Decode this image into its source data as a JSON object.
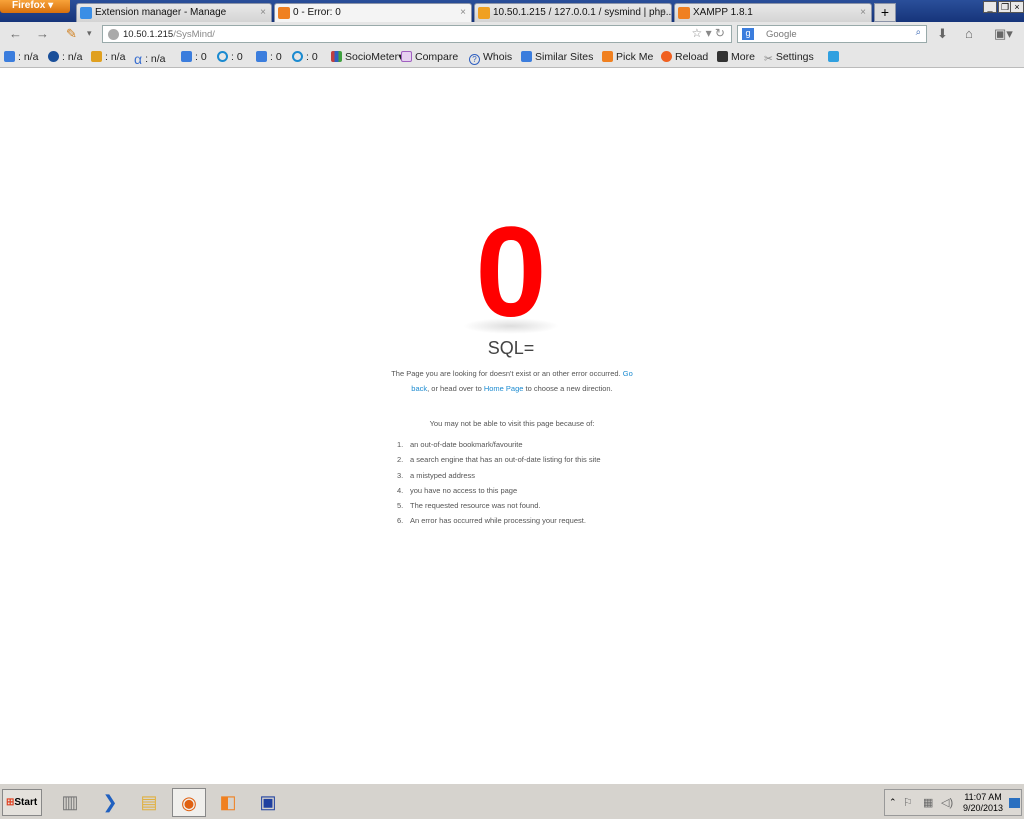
{
  "browser": {
    "menu_label": "Firefox",
    "tabs": [
      {
        "label": "Extension manager - Manage",
        "color": "#3a8ee6"
      },
      {
        "label": "0 - Error: 0",
        "color": "#f08020",
        "active": true
      },
      {
        "label": "10.50.1.215 / 127.0.0.1 / sysmind | php...",
        "color": "#f0a020"
      },
      {
        "label": "XAMPP 1.8.1",
        "color": "#f08020"
      }
    ],
    "new_tab": "+"
  },
  "navbar": {
    "url_host": "10.50.1.215",
    "url_path": "/SysMind/",
    "search_placeholder": "Google"
  },
  "bookmarks": [
    {
      "label": ": n/a",
      "color": "#3b7ddd"
    },
    {
      "label": ": n/a",
      "color": "#1a4f9a"
    },
    {
      "label": ": n/a",
      "color": "#e0a020"
    },
    {
      "label": ": n/a",
      "color": "#3a6fd0"
    },
    {
      "label": ": 0",
      "color": "#3b7ddd"
    },
    {
      "label": ": 0",
      "color": "#1a8ad0"
    },
    {
      "label": ": 0",
      "color": "#3b7ddd"
    },
    {
      "label": ": 0",
      "color": "#1a8ad0"
    },
    {
      "label": "SocioMeter▾",
      "color": "#c04040"
    },
    {
      "label": "Compare",
      "color": "#a060c0"
    },
    {
      "label": "Whois",
      "color": "#3060c0"
    },
    {
      "label": "Similar Sites",
      "color": "#3b7ddd"
    },
    {
      "label": "Pick Me",
      "color": "#f08020"
    },
    {
      "label": "Reload",
      "color": "#f06020"
    },
    {
      "label": "More",
      "color": "#333"
    },
    {
      "label": "Settings",
      "color": "#888"
    },
    {
      "label": "",
      "color": "#30a0e0"
    }
  ],
  "page": {
    "code": "0",
    "title": "SQL=",
    "msg_1": "The Page you are looking for doesn't exist or an other error occurred. ",
    "go_back": "Go back",
    "msg_2": ", or head over to ",
    "home_page": "Home Page",
    "msg_3": " to choose a new direction.",
    "why": "You may not be able to visit this page because of:",
    "reasons": [
      "an out-of-date bookmark/favourite",
      "a search engine that has an out-of-date listing for this site",
      "a mistyped address",
      "you have no access to this page",
      "The requested resource was not found.",
      "An error has occurred while processing your request."
    ]
  },
  "taskbar": {
    "start": "Start",
    "time": "11:07 AM",
    "date": "9/20/2013"
  }
}
